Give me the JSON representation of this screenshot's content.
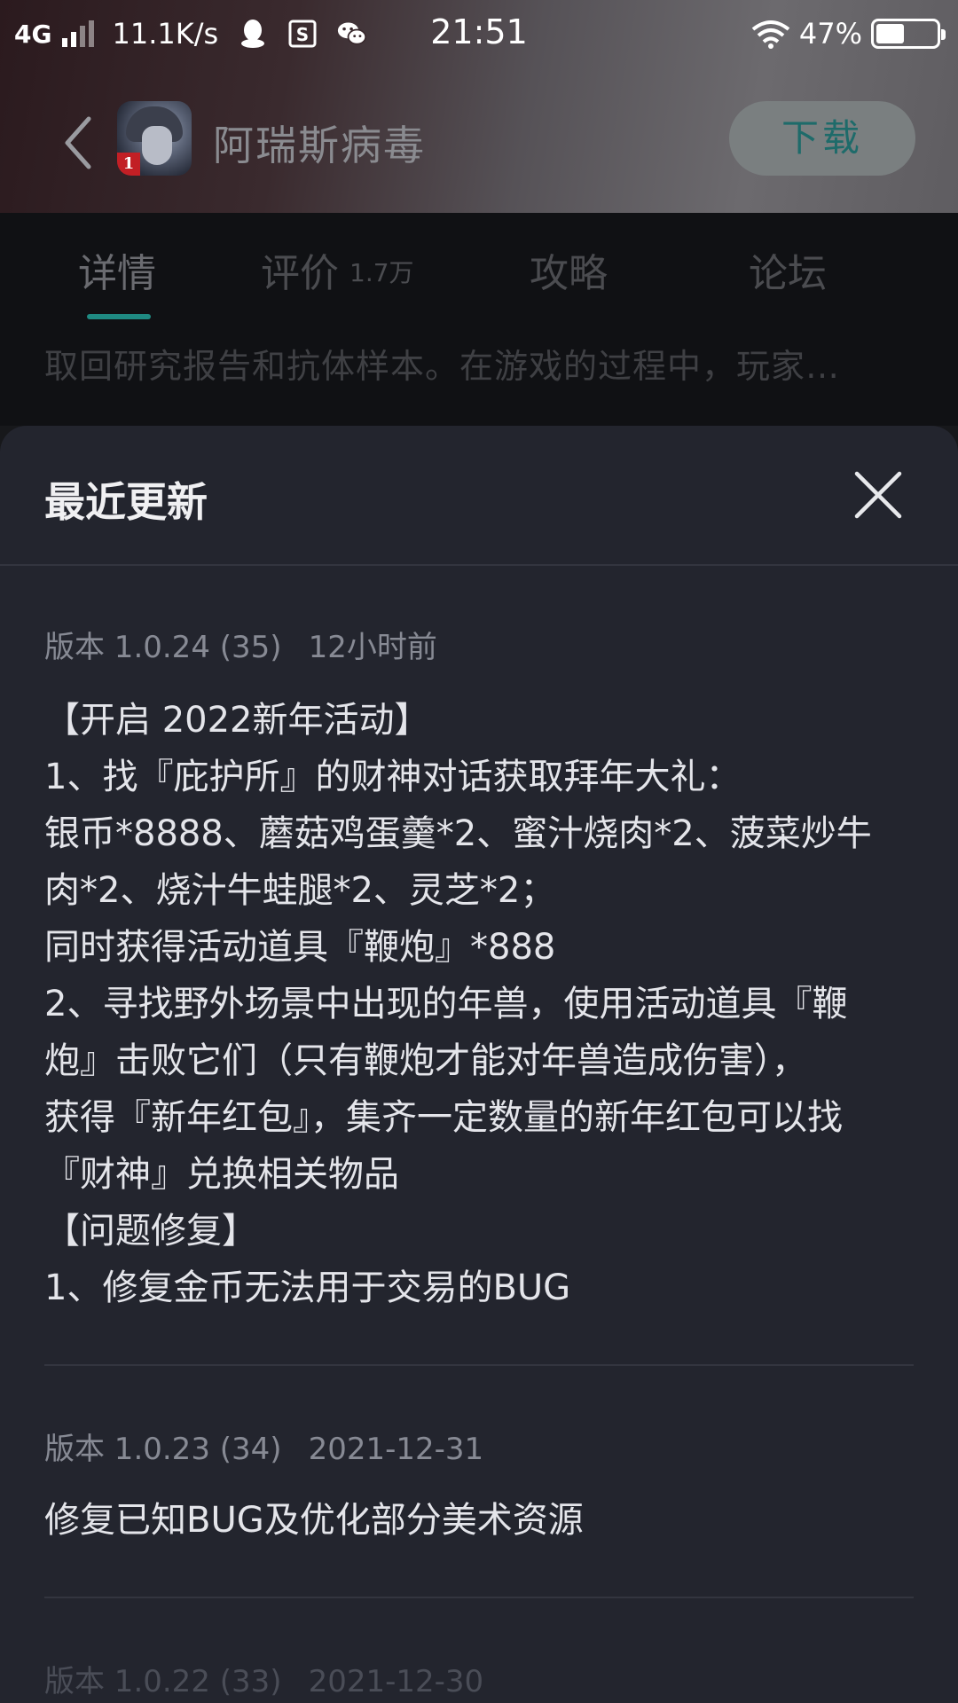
{
  "status_bar": {
    "network": "4G",
    "speed": "11.1K/s",
    "time": "21:51",
    "battery": "47%",
    "battery_level": 0.47
  },
  "app_bar": {
    "title": "阿瑞斯病毒",
    "download_label": "下载",
    "icon_badge": "1"
  },
  "tabs": [
    {
      "label": "详情",
      "count": ""
    },
    {
      "label": "评价",
      "count": "1.7万"
    },
    {
      "label": "攻略",
      "count": ""
    },
    {
      "label": "论坛",
      "count": ""
    }
  ],
  "description_snippet": "取回研究报告和抗体样本。在游戏的过程中，玩家…",
  "sheet": {
    "title": "最近更新",
    "entries": [
      {
        "version": "版本 1.0.24 (35)",
        "date": "12小时前",
        "lines": [
          "【开启 2022新年活动】",
          "1、找『庇护所』的财神对话获取拜年大礼：",
          "银币*8888、蘑菇鸡蛋羹*2、蜜汁烧肉*2、菠菜炒牛",
          "肉*2、烧汁牛蛙腿*2、灵芝*2；",
          "同时获得活动道具『鞭炮』*888",
          "2、寻找野外场景中出现的年兽，使用活动道具『鞭",
          "炮』击败它们（只有鞭炮才能对年兽造成伤害），",
          "获得『新年红包』，集齐一定数量的新年红包可以找",
          "『财神』兑换相关物品",
          "【问题修复】",
          "1、修复金币无法用于交易的BUG"
        ]
      },
      {
        "version": "版本 1.0.23 (34)",
        "date": "2021-12-31",
        "lines": [
          "修复已知BUG及优化部分美术资源"
        ]
      },
      {
        "version": "版本 1.0.22 (33)",
        "date": "2021-12-30",
        "lines": []
      }
    ]
  },
  "colors": {
    "accent": "#1f8a82",
    "sheet_bg": "#23252e",
    "text_primary": "#e4e5ea",
    "text_meta": "#878a94"
  }
}
